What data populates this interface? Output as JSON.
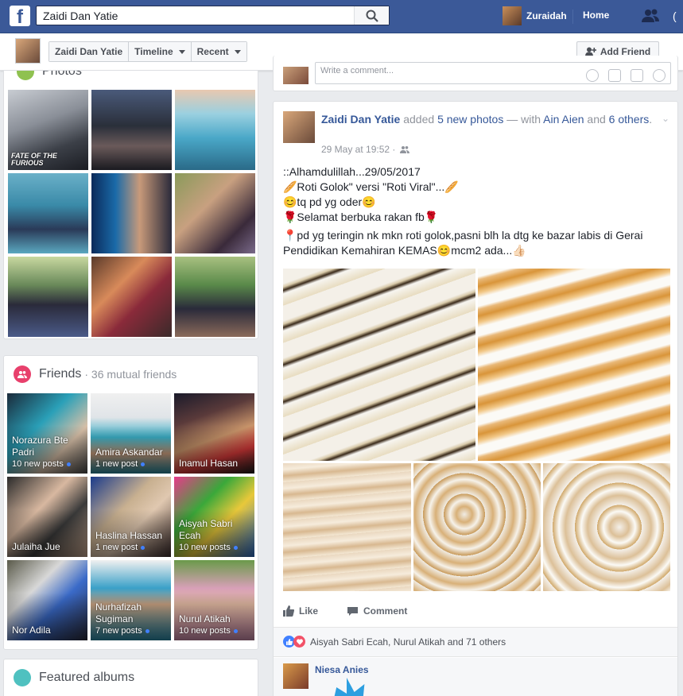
{
  "topbar": {
    "logo": "f",
    "search_value": "Zaidi Dan Yatie",
    "user_name": "Zuraidah",
    "home_label": "Home",
    "overflow_glyph": "(",
    "colors": {
      "bar": "#3b5998",
      "link": "#365899"
    }
  },
  "subheader": {
    "profile_name": "Zaidi Dan Yatie",
    "tabs": [
      "Timeline",
      "Recent"
    ],
    "add_friend_label": "Add Friend"
  },
  "photos": {
    "title": "Photos",
    "cover_text": "FATE OF THE FURIOUS"
  },
  "friends": {
    "title": "Friends",
    "mutual": "· 36 mutual friends",
    "items": [
      {
        "name": "Norazura Bte Padri",
        "posts": "10 new posts"
      },
      {
        "name": "Amira Askandar",
        "posts": "1 new post"
      },
      {
        "name": "Inamul Hasan",
        "posts": ""
      },
      {
        "name": "Julaiha Jue",
        "posts": ""
      },
      {
        "name": "Haslina Hassan",
        "posts": "1 new post"
      },
      {
        "name": "Aisyah Sabri Ecah",
        "posts": "10 new posts"
      },
      {
        "name": "Nor Adila",
        "posts": ""
      },
      {
        "name": "Nurhafizah Sugiman",
        "posts": "7 new posts"
      },
      {
        "name": "Nurul Atikah",
        "posts": "10 new posts"
      }
    ]
  },
  "albums": {
    "title": "Featured albums"
  },
  "comment_box": {
    "placeholder": "Write a comment..."
  },
  "post": {
    "author": "Zaidi Dan Yatie",
    "action": " added ",
    "photos_link": "5 new photos",
    "with_text": " — with ",
    "tagged": "Ain Aien",
    "and_text": " and ",
    "others_link": "6 others",
    "period": ".",
    "timestamp": "29 May at 19:52 ·",
    "lines": [
      "::Alhamdulillah...29/05/2017",
      "🥖Roti Golok\" versi \"Roti Viral\"...🥖",
      "😊tq pd yg oder😊",
      "🌹Selamat berbuka rakan fb🌹",
      "",
      "📍pd yg teringin nk mkn roti golok,pasni blh la dtg ke bazar labis di Gerai Pendidikan Kemahiran KEMAS😊mcm2 ada...👍🏻"
    ],
    "like_label": "Like",
    "comment_label": "Comment",
    "reactions_text": "Aisyah Sabri Ecah, Nurul Atikah and 71 others",
    "commenter": "Niesa Anies"
  }
}
